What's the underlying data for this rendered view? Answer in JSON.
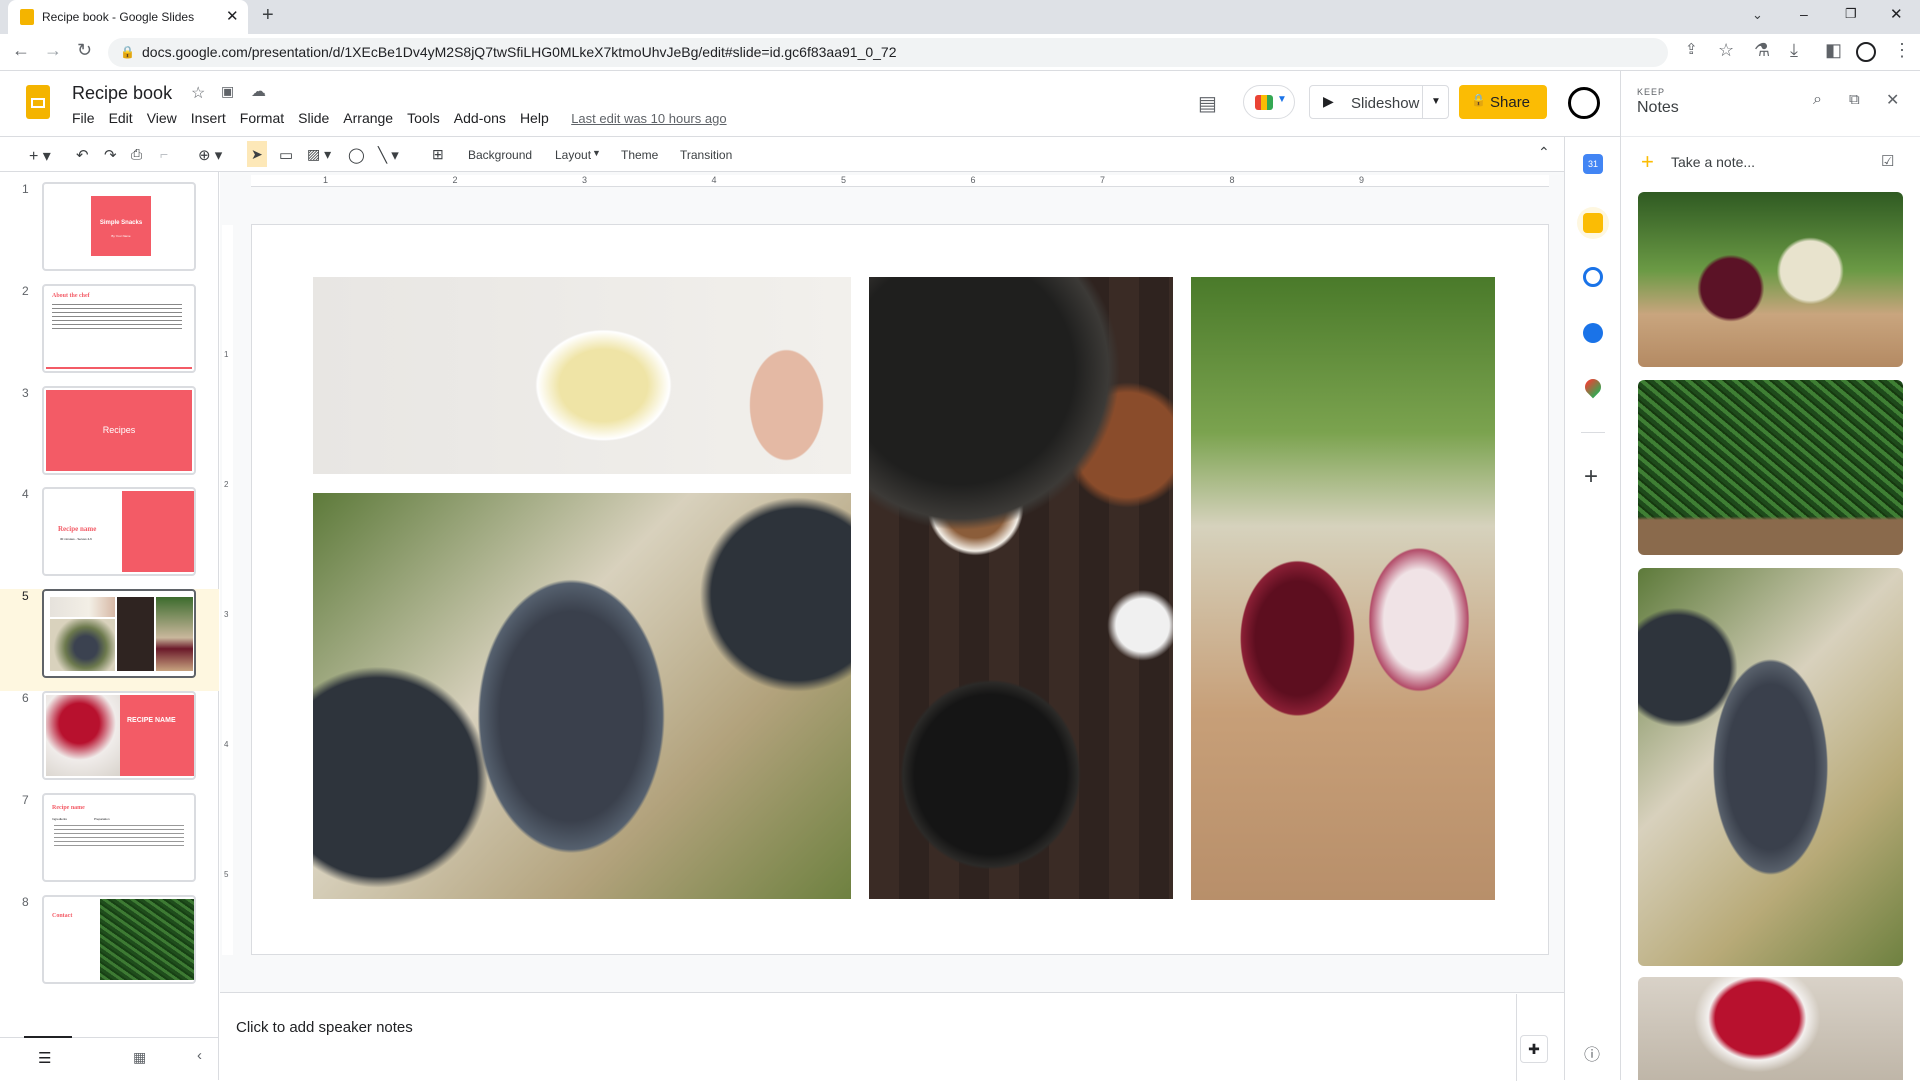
{
  "browser": {
    "tab_title": "Recipe book - Google Slides",
    "url": "docs.google.com/presentation/d/1XEcBe1Dv4yM2S8jQ7twSfiLHG0MLkeX7ktmoUhvJeBg/edit#slide=id.gc6f83aa91_0_72"
  },
  "app": {
    "title": "Recipe book",
    "menu": [
      "File",
      "Edit",
      "View",
      "Insert",
      "Format",
      "Slide",
      "Arrange",
      "Tools",
      "Add-ons",
      "Help"
    ],
    "last_edit": "Last edit was 10 hours ago",
    "slideshow_label": "Slideshow",
    "share_label": "Share",
    "accent": "#fbbc04"
  },
  "toolbar": {
    "background": "Background",
    "layout": "Layout",
    "theme": "Theme",
    "transition": "Transition"
  },
  "ruler": {
    "marks": [
      "1",
      "2",
      "3",
      "4",
      "5",
      "6",
      "7",
      "8",
      "9"
    ],
    "vmarks": [
      "1",
      "2",
      "3",
      "4",
      "5"
    ]
  },
  "filmstrip": {
    "selected": 5,
    "slides": [
      {
        "num": "1",
        "title": "Simple Snacks",
        "subtitle": "By Your Name"
      },
      {
        "num": "2",
        "title": "About the chef"
      },
      {
        "num": "3",
        "title": "Recipes"
      },
      {
        "num": "4",
        "title": "Recipe name",
        "subtitle": "30 minutes - Serves 4-6"
      },
      {
        "num": "5"
      },
      {
        "num": "6",
        "title": "RECIPE NAME"
      },
      {
        "num": "7",
        "title": "Recipe name",
        "subtitle": "Ingredients",
        "extra": "Preparation"
      },
      {
        "num": "8",
        "title": "Contact"
      }
    ]
  },
  "theme_color": "#f35b66",
  "notes": {
    "placeholder": "Click to add speaker notes"
  },
  "keep": {
    "brand": "KEEP",
    "title": "Notes",
    "take_note": "Take a note..."
  }
}
